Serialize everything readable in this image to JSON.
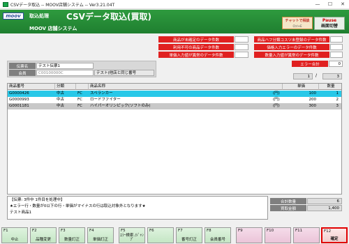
{
  "window": {
    "title": "CSVデータ取込 -- MOOV店舗システム -- Ver3.21.04T"
  },
  "header": {
    "logo": "moov",
    "process_label": "取込処理",
    "title": "CSVデータ取込(買取)",
    "system_name": "MOOV 店舗システム",
    "chat_button": {
      "label": "チャットで相談",
      "shortcut": "Ctrl+E"
    },
    "pause_button": {
      "label": "Pause",
      "sub": "画面切替"
    }
  },
  "warnings_left": [
    {
      "label": "商品が未確定のデータ件数",
      "value": ""
    },
    {
      "label": "利用不可の商品データ件数",
      "value": ""
    },
    {
      "label": "単価入力値が異常のデータ件数",
      "value": ""
    }
  ],
  "warnings_right": [
    {
      "label": "商品ハフ分類コスツ未登録のデータ件数",
      "value": ""
    },
    {
      "label": "価格入力エラーのデータ件数",
      "value": ""
    },
    {
      "label": "数量入力値が異常のデータ件数",
      "value": ""
    }
  ],
  "error_total": {
    "label": "エラー合計",
    "value": "0"
  },
  "slip": {
    "slip_no_label": "伝票名",
    "slip_no_value": "テスト伝票1",
    "member_label": "会員",
    "member_code": "C00100000C",
    "member_name": "テスト(他店と同じ番号"
  },
  "pager": {
    "current": "1",
    "separator": "/",
    "total": "3"
  },
  "table": {
    "headers": [
      "商品番号",
      "分類",
      "",
      "商品名称",
      "単価",
      "数量"
    ],
    "rows": [
      {
        "code": "G0000426",
        "class": "中古",
        "type": "FC",
        "name": "スペランカー",
        "unit": "(円)",
        "price": "100",
        "qty": "1"
      },
      {
        "code": "G0000993",
        "class": "中古",
        "type": "FC",
        "name": "ロードファイター",
        "unit": "(円)",
        "price": "200",
        "qty": "2"
      },
      {
        "code": "G0001181",
        "class": "中古",
        "type": "FC",
        "name": "ハイパーオリンピック(ソフトのみ)",
        "unit": "(円)",
        "price": "300",
        "qty": "3"
      }
    ]
  },
  "status": {
    "line1": "【伝票: 3件中 1件目を処理中】",
    "line2": "★エラー行・数量が0以下の行・単価がマイナスの行は取込対象外となります★",
    "line3": "テスト商品1"
  },
  "totals": {
    "qty_label": "合計数量",
    "qty_value": "6",
    "amount_label": "買取金額",
    "amount_value": "1,400"
  },
  "function_keys": [
    {
      "key": "F1",
      "label": "中止"
    },
    {
      "key": "F2",
      "label": "品種変更"
    },
    {
      "key": "F3",
      "label": "数量訂正"
    },
    {
      "key": "F4",
      "label": "単価訂正"
    },
    {
      "key": "F5",
      "label": "ｴﾗｰ検索 /ｼﾞｬﾝﾌﾟ"
    },
    {
      "key": "F6",
      "label": ""
    },
    {
      "key": "F7",
      "label": "番号訂正"
    },
    {
      "key": "F8",
      "label": "会員番号"
    },
    {
      "key": "F9",
      "label": ""
    },
    {
      "key": "F10",
      "label": ""
    },
    {
      "key": "F11",
      "label": ""
    },
    {
      "key": "F12",
      "label": "確定"
    }
  ],
  "colors": {
    "header_green": "#1f7f30",
    "warning_red": "#e02020",
    "selected_row": "#28c8e8",
    "active_key_border": "#e00000"
  }
}
